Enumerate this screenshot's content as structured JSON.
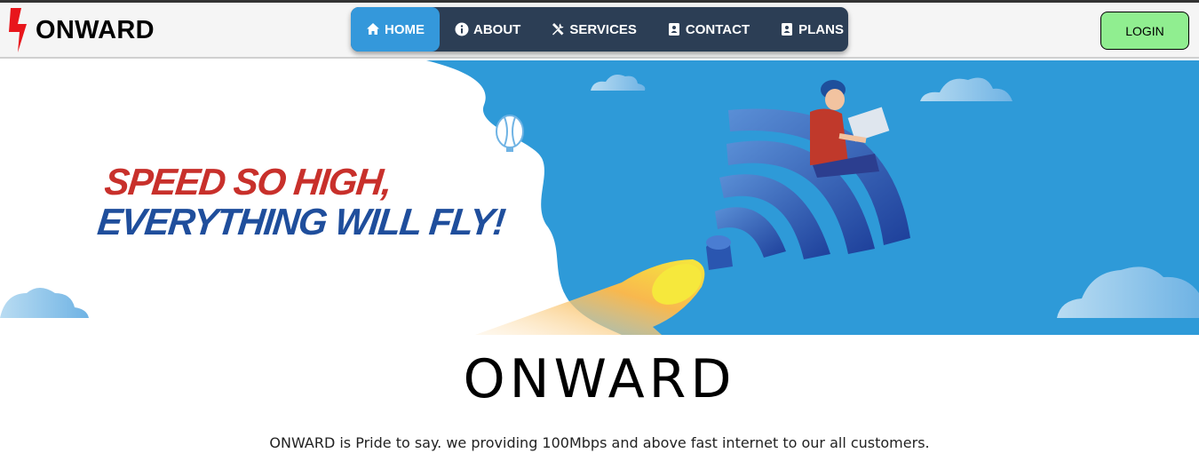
{
  "brand": {
    "name": "ONWARD",
    "logo_icon": "lightning-bolt-icon",
    "logo_color": "#e8161c"
  },
  "nav": {
    "items": [
      {
        "label": "HOME",
        "icon": "home-icon",
        "active": true
      },
      {
        "label": "ABOUT",
        "icon": "info-icon",
        "active": false
      },
      {
        "label": "SERVICES",
        "icon": "tools-icon",
        "active": false
      },
      {
        "label": "CONTACT",
        "icon": "contact-card-icon",
        "active": false
      },
      {
        "label": "PLANS",
        "icon": "plans-card-icon",
        "active": false
      }
    ],
    "bar_color": "#2c3e55",
    "active_color": "#3498db"
  },
  "login": {
    "label": "LOGIN",
    "color": "#90ee90"
  },
  "hero": {
    "line1": "SPEED SO HIGH,",
    "line2": "EVERYTHING WILL FLY!",
    "line1_color": "#c8302b",
    "line2_color": "#1f4e9c",
    "sky_color": "#2e9ad8"
  },
  "main": {
    "title": "ONWARD",
    "tagline": "ONWARD is Pride to say. we providing 100Mbps and above fast internet to our all customers."
  }
}
